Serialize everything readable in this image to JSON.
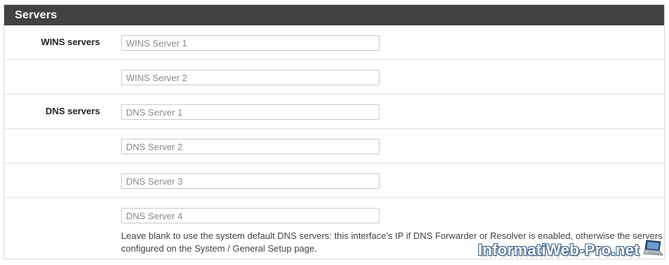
{
  "panel": {
    "title": "Servers"
  },
  "wins": {
    "label": "WINS servers",
    "fields": [
      {
        "placeholder": "WINS Server 1",
        "value": ""
      },
      {
        "placeholder": "WINS Server 2",
        "value": ""
      }
    ]
  },
  "dns": {
    "label": "DNS servers",
    "fields": [
      {
        "placeholder": "DNS Server 1",
        "value": ""
      },
      {
        "placeholder": "DNS Server 2",
        "value": ""
      },
      {
        "placeholder": "DNS Server 3",
        "value": ""
      },
      {
        "placeholder": "DNS Server 4",
        "value": ""
      }
    ],
    "help": "Leave blank to use the system default DNS servers: this interface's IP if DNS Forwarder or Resolver is enabled, otherwise the servers configured on the System / General Setup page."
  },
  "watermark": {
    "text": "InformatiWeb-Pro.net",
    "icon": "laptop-icon"
  }
}
